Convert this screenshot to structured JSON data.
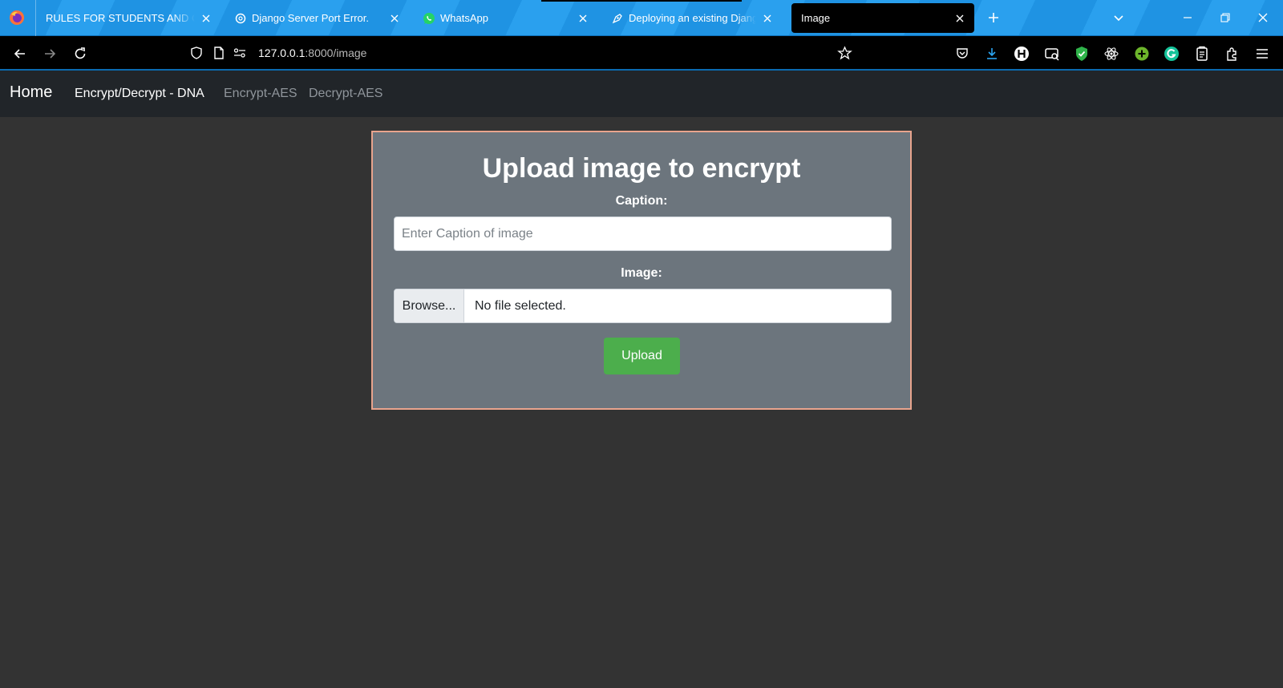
{
  "browser": {
    "tabs": [
      {
        "title": "RULES FOR STUDENTS AND CHILDREN",
        "favicon": "document-icon",
        "active": false
      },
      {
        "title": "Django Server Port Error.",
        "favicon": "openai-icon",
        "active": false
      },
      {
        "title": "WhatsApp",
        "favicon": "whatsapp-icon",
        "active": false
      },
      {
        "title": "Deploying an existing Django project",
        "favicon": "pen-nib-icon",
        "active": false
      },
      {
        "title": "Image",
        "favicon": "",
        "active": true
      }
    ],
    "url": {
      "host": "127.0.0.1",
      "path": ":8000/image"
    },
    "accent_color": "#1f93e3"
  },
  "navbar": {
    "brand": "Home",
    "links": [
      {
        "label": "Encrypt/Decrypt - DNA",
        "active": true
      },
      {
        "label": "Encrypt-AES",
        "active": false
      },
      {
        "label": "Decrypt-AES",
        "active": false
      }
    ],
    "background": "#212529"
  },
  "form": {
    "title": "Upload image to encrypt",
    "caption_label": "Caption:",
    "caption_placeholder": "Enter Caption of image",
    "caption_value": "",
    "image_label": "Image:",
    "browse_label": "Browse...",
    "file_status": "No file selected.",
    "submit_label": "Upload",
    "card_color": "#6c757d",
    "border_color": "#e8a48d",
    "button_color": "#4cae4c"
  }
}
